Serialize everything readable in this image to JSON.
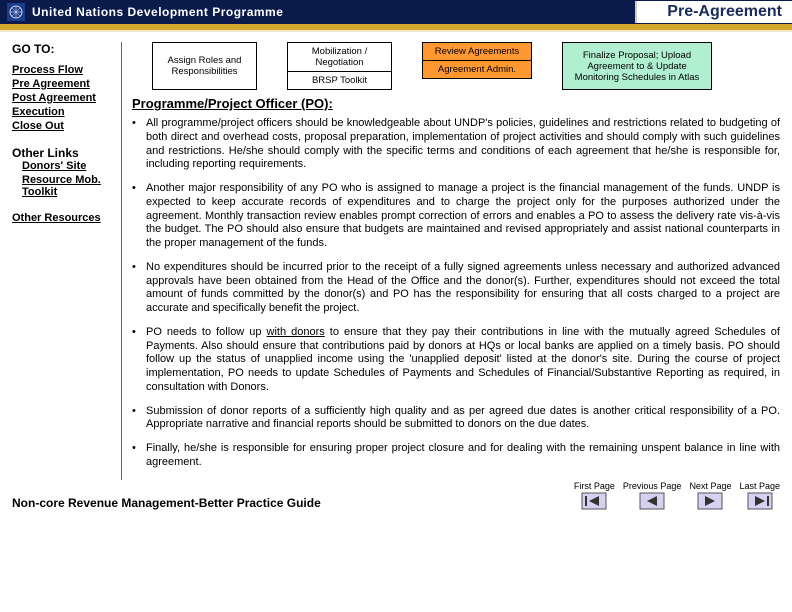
{
  "header": {
    "org": "United Nations Development Programme",
    "page_title": "Pre-Agreement"
  },
  "sidebar": {
    "goto": "GO TO:",
    "links": {
      "process_flow": "Process Flow",
      "pre_agreement": "Pre Agreement",
      "post_agreement": "Post Agreement",
      "execution": "Execution",
      "close_out": "Close Out"
    },
    "other_links": "Other Links",
    "sublinks": {
      "donors_site": "Donors' Site",
      "resource_mob": "Resource Mob. Toolkit"
    },
    "other_resources": "Other Resources"
  },
  "flow": {
    "box1": "Assign Roles and Responsibilities",
    "box2a": "Mobilization / Negotiation",
    "box2b": "BRSP Toolkit",
    "box3a": "Review Agreements",
    "box3b": "Agreement Admin.",
    "box4": "Finalize Proposal; Upload Agreement to & Update Monitoring Schedules in Atlas"
  },
  "content": {
    "heading": "Programme/Project Officer (PO):",
    "b1": "All programme/project officers should be knowledgeable about UNDP's policies, guidelines and restrictions related to budgeting of both direct and overhead costs, proposal preparation, implementation of project activities and should comply with such guidelines and restrictions.  He/she should comply with the specific terms and conditions of each agreement that he/she is responsible for, including reporting requirements.",
    "b2": "Another major responsibility of any PO who is assigned to manage a project is the financial management of the funds. UNDP is expected to keep accurate records of expenditures and  to charge the project only for the purposes authorized under the agreement. Monthly transaction review enables prompt correction of errors and enables a PO to assess the delivery rate vis-à-vis the budget. The PO should also ensure that budgets are maintained and revised appropriately and assist national counterparts in the proper management of the funds.",
    "b3": "No expenditures should be incurred prior to the receipt of a fully signed agreements unless necessary and authorized advanced approvals have been obtained  from the Head of the Office and the donor(s).  Further,  expenditures should not exceed the total amount of funds committed by the donor(s) and PO has the responsibility for ensuring that all costs charged to a project are accurate and specifically benefit the project.",
    "b4a": "PO needs to follow up ",
    "b4u": "with donors",
    "b4b": " to ensure that they pay their contributions in line with the mutually agreed Schedules of Payments.  Also should ensure that contributions paid by donors at HQs or local banks are applied on a timely basis.  PO should  follow up the status of unapplied income using the 'unapplied deposit' listed at the donor's site.  During the course of project implementation,  PO needs to update Schedules of Payments and Schedules of Financial/Substantive Reporting as  required, in consultation with Donors.",
    "b5": "Submission of donor reports of a sufficiently high quality and as per agreed due dates is another critical responsibility of a PO.  Appropriate narrative and financial reports should be submitted to donors on the due dates.",
    "b6": "Finally, he/she is responsible for ensuring proper  project closure and for dealing with the remaining unspent balance in line with agreement."
  },
  "footer": {
    "guide": "Non-core Revenue Management-Better Practice Guide",
    "nav": {
      "first": "First Page",
      "prev": "Previous Page",
      "next": "Next Page",
      "last": "Last Page"
    }
  }
}
